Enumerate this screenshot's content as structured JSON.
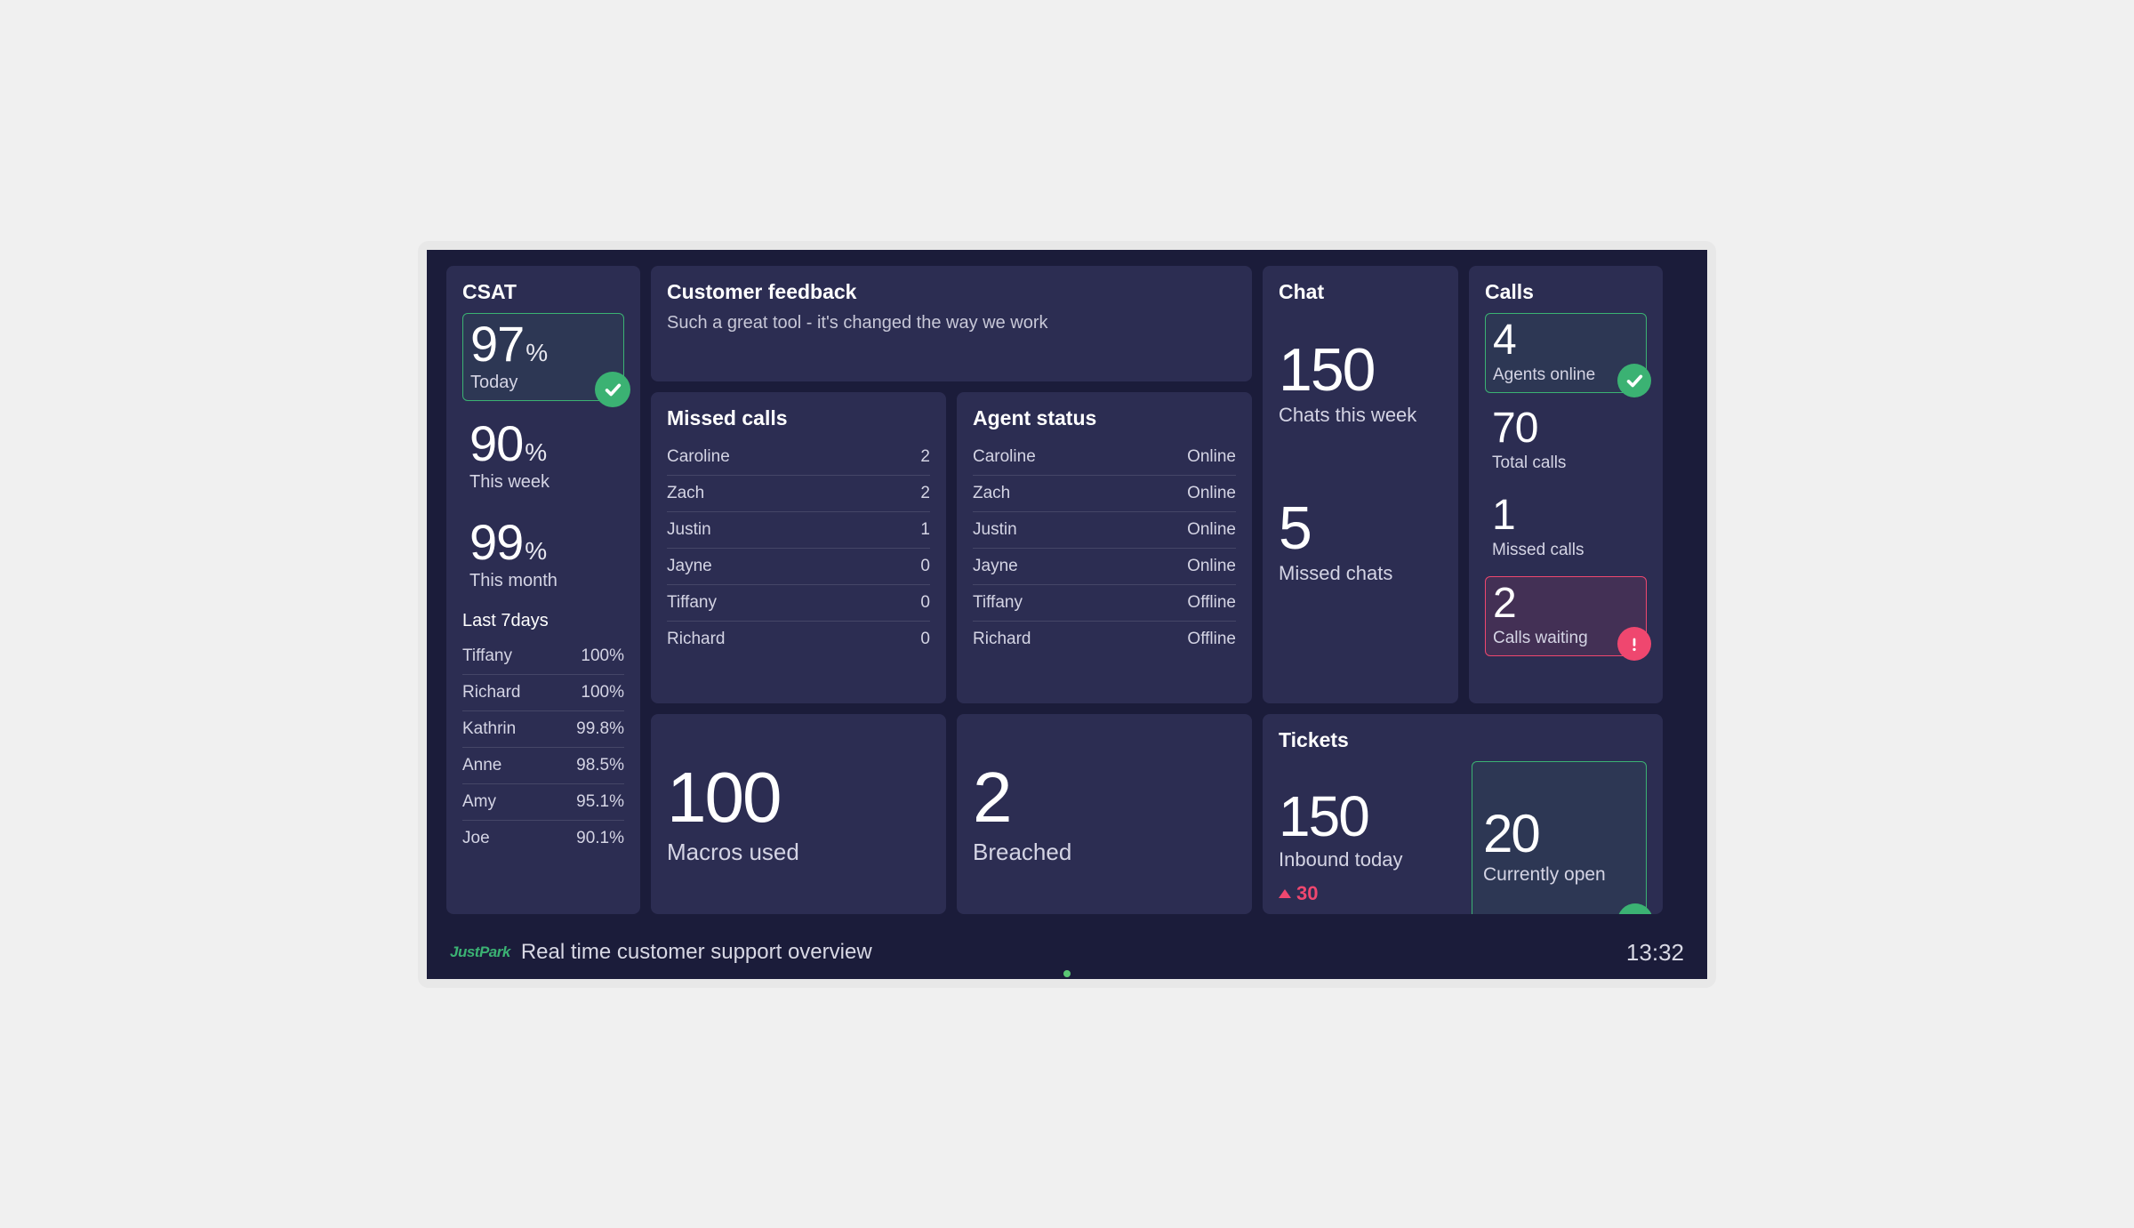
{
  "csat": {
    "title": "CSAT",
    "today": {
      "value": "97",
      "unit": "%",
      "label": "Today"
    },
    "week": {
      "value": "90",
      "unit": "%",
      "label": "This week"
    },
    "month": {
      "value": "99",
      "unit": "%",
      "label": "This month"
    },
    "last7_title": "Last 7days",
    "last7": [
      {
        "name": "Tiffany",
        "value": "100%"
      },
      {
        "name": "Richard",
        "value": "100%"
      },
      {
        "name": "Kathrin",
        "value": "99.8%"
      },
      {
        "name": "Anne",
        "value": "98.5%"
      },
      {
        "name": "Amy",
        "value": "95.1%"
      },
      {
        "name": "Joe",
        "value": "90.1%"
      }
    ]
  },
  "feedback": {
    "title": "Customer feedback",
    "text": "Such a great tool - it's changed the way we work"
  },
  "missed_calls": {
    "title": "Missed calls",
    "rows": [
      {
        "name": "Caroline",
        "value": "2"
      },
      {
        "name": "Zach",
        "value": "2"
      },
      {
        "name": "Justin",
        "value": "1"
      },
      {
        "name": "Jayne",
        "value": "0"
      },
      {
        "name": "Tiffany",
        "value": "0"
      },
      {
        "name": "Richard",
        "value": "0"
      }
    ]
  },
  "agent_status": {
    "title": "Agent status",
    "rows": [
      {
        "name": "Caroline",
        "value": "Online"
      },
      {
        "name": "Zach",
        "value": "Online"
      },
      {
        "name": "Justin",
        "value": "Online"
      },
      {
        "name": "Jayne",
        "value": "Online"
      },
      {
        "name": "Tiffany",
        "value": "Offline"
      },
      {
        "name": "Richard",
        "value": "Offline"
      }
    ]
  },
  "macros": {
    "value": "100",
    "label": "Macros used"
  },
  "breached": {
    "value": "2",
    "label": "Breached"
  },
  "chat": {
    "title": "Chat",
    "week": {
      "value": "150",
      "label": "Chats this week"
    },
    "missed": {
      "value": "5",
      "label": "Missed chats"
    }
  },
  "tickets": {
    "title": "Tickets",
    "inbound": {
      "value": "150",
      "label": "Inbound today",
      "delta": "30"
    },
    "open": {
      "value": "20",
      "label": "Currently open"
    }
  },
  "calls": {
    "title": "Calls",
    "agents": {
      "value": "4",
      "label": "Agents online"
    },
    "total": {
      "value": "70",
      "label": "Total calls"
    },
    "missed": {
      "value": "1",
      "label": "Missed calls"
    },
    "waiting": {
      "value": "2",
      "label": "Calls waiting"
    }
  },
  "footer": {
    "logo": "JustPark",
    "title": "Real time customer support overview",
    "time": "13:32"
  }
}
